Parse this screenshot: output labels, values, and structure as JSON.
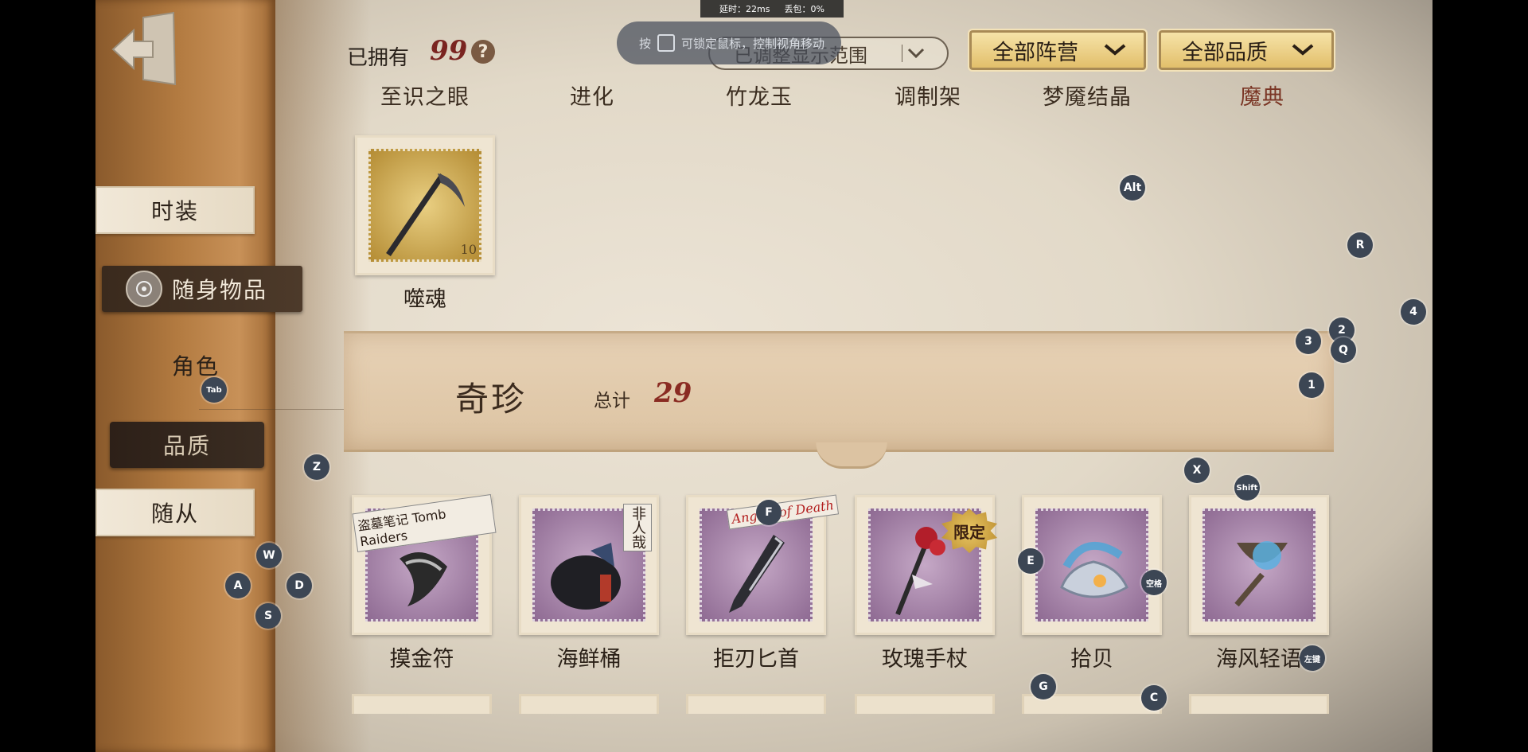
{
  "top_stats": {
    "latency": "延时：22ms",
    "packet_loss": "丢包：0%"
  },
  "hint": {
    "prefix": "按",
    "text": "可锁定鼠标，控制视角移动"
  },
  "header": {
    "owned_label": "已拥有",
    "owned_count": "99",
    "help": "?"
  },
  "filters": {
    "range": "已调整显示范围",
    "faction": "全部阵营",
    "quality": "全部品质"
  },
  "tabs": [
    {
      "label": "至识之眼"
    },
    {
      "label": "进化"
    },
    {
      "label": "竹龙玉"
    },
    {
      "label": "调制架"
    },
    {
      "label": "梦魇结晶"
    },
    {
      "label": "魔典"
    }
  ],
  "sidebar": {
    "items": [
      {
        "label": "时装"
      },
      {
        "label": "随身物品"
      },
      {
        "label": "角色"
      },
      {
        "label": "品质"
      },
      {
        "label": "随从"
      }
    ]
  },
  "top_item": {
    "label": "噬魂",
    "stamp_value": "10"
  },
  "section": {
    "title": "奇珍",
    "total_label": "总计",
    "total": "29"
  },
  "items": [
    {
      "label": "摸金符",
      "tag": "盗墓笔记 Tomb Raiders"
    },
    {
      "label": "海鲜桶",
      "tag": "非人哉"
    },
    {
      "label": "拒刃匕首",
      "tag": "Angels of Death"
    },
    {
      "label": "玫瑰手杖",
      "tag": "限定"
    },
    {
      "label": "拾贝",
      "tag": ""
    },
    {
      "label": "海风轻语",
      "tag": ""
    }
  ],
  "key_badges": [
    "Alt",
    "R",
    "4",
    "2",
    "3",
    "Q",
    "1",
    "Tab",
    "Z",
    "X",
    "Shift",
    "F",
    "E",
    "空格",
    "W",
    "A",
    "D",
    "S",
    "左键",
    "G",
    "C"
  ],
  "colors": {
    "accent_red": "#7a2420",
    "gold": "#e2bf6b",
    "badge": "#3c4654"
  }
}
